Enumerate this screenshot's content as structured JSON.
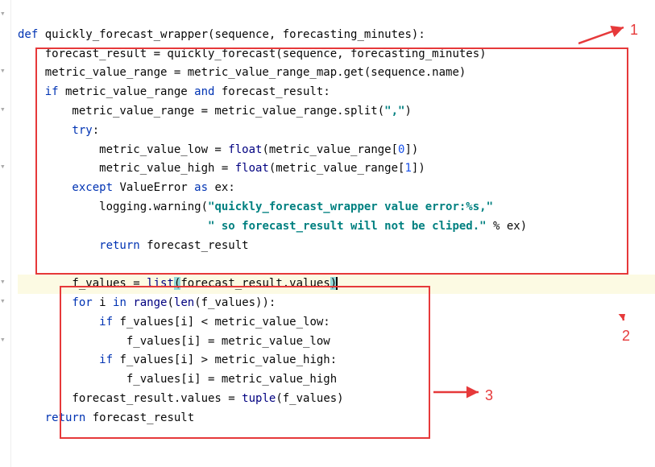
{
  "code": {
    "l01_def": "def",
    "l01_name": "quickly_forecast_wrapper(sequence, forecasting_minutes):",
    "l02_a": "    forecast_result = quickly_forecast(sequence, forecasting_minutes)",
    "l03_a": "    metric_value_range = metric_value_range_map.get(sequence.name)",
    "l04_if": "    if",
    "l04_rest": " metric_value_range ",
    "l04_and": "and",
    "l04_rest2": " forecast_result:",
    "l05_a": "        metric_value_range = metric_value_range.split(",
    "l05_str": "\",\"",
    "l05_b": ")",
    "l06_try": "        try",
    "l06_colon": ":",
    "l07_a": "            metric_value_low = ",
    "l07_float": "float",
    "l07_b": "(metric_value_range[",
    "l07_num": "0",
    "l07_c": "])",
    "l08_a": "            metric_value_high = ",
    "l08_float": "float",
    "l08_b": "(metric_value_range[",
    "l08_num": "1",
    "l08_c": "])",
    "l09_except": "        except",
    "l09_err": " ValueError ",
    "l09_as": "as",
    "l09_ex": " ex:",
    "l10_a": "            logging.warning(",
    "l10_str": "\"quickly_forecast_wrapper value error:%s,\"",
    "l11_pad": "                            ",
    "l11_str": "\" so forecast_result will not be cliped.\"",
    "l11_b": " % ex)",
    "l12_ret": "            return",
    "l12_b": " forecast_result",
    "l13_blank": "",
    "l14_a": "        f_values = ",
    "l14_list": "list",
    "l14_paren_open": "(",
    "l14_b": "forecast_result.values",
    "l14_paren_close": ")",
    "l15_for": "        for",
    "l15_a": " i ",
    "l15_in": "in",
    "l15_b": " ",
    "l15_range": "range",
    "l15_c": "(",
    "l15_len": "len",
    "l15_d": "(f_values)):",
    "l16_if": "            if",
    "l16_a": " f_values[i] < metric_value_low:",
    "l17_a": "                f_values[i] = metric_value_low",
    "l18_if": "            if",
    "l18_a": " f_values[i] > metric_value_high:",
    "l19_a": "                f_values[i] = metric_value_high",
    "l20_a": "        forecast_result.values = ",
    "l20_tuple": "tuple",
    "l20_b": "(f_values)",
    "l21_ret": "    return",
    "l21_b": " forecast_result"
  },
  "annotations": {
    "label1": "1",
    "label2": "2",
    "label3": "3"
  }
}
